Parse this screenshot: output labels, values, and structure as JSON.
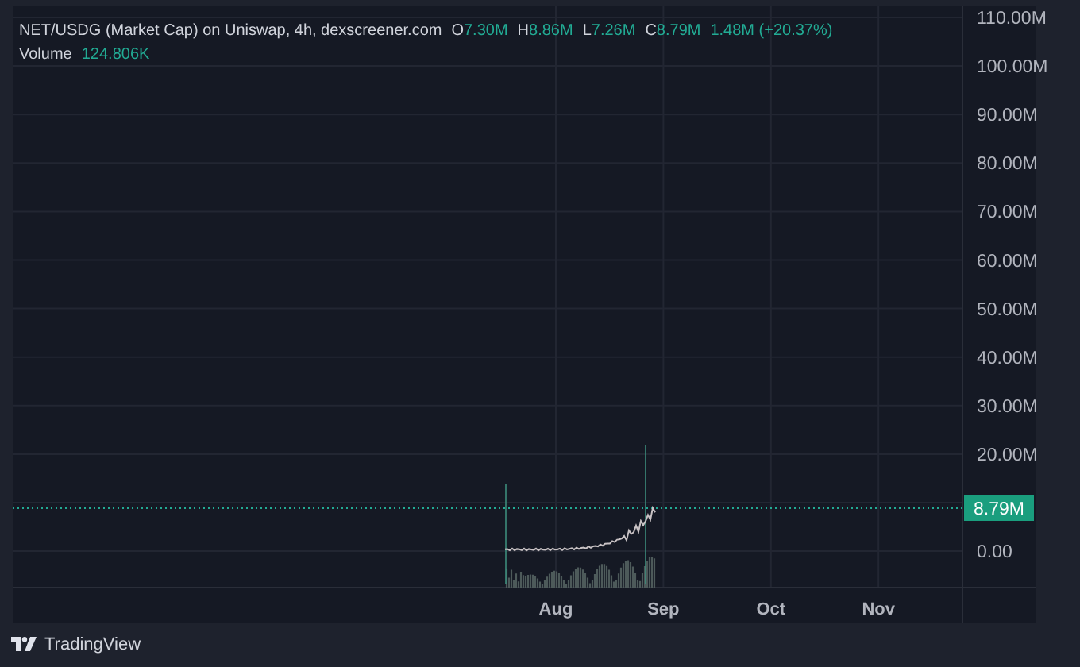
{
  "legend": {
    "title": "NET/USDG (Market Cap) on Uniswap, 4h, dexscreener.com",
    "ohlc": [
      {
        "label": "O",
        "value": "7.30M"
      },
      {
        "label": "H",
        "value": "8.86M"
      },
      {
        "label": "L",
        "value": "7.26M"
      },
      {
        "label": "C",
        "value": "8.79M"
      }
    ],
    "change": "1.48M (+20.37%)",
    "volume_label": "Volume",
    "volume_value": "124.806K"
  },
  "price_axis": {
    "ticks": [
      "110.00M",
      "100.00M",
      "90.00M",
      "80.00M",
      "70.00M",
      "60.00M",
      "50.00M",
      "40.00M",
      "30.00M",
      "20.00M",
      "0.00"
    ],
    "last_price": "8.79M"
  },
  "time_axis": {
    "ticks": [
      "Aug",
      "Sep",
      "Oct",
      "Nov"
    ]
  },
  "footer": {
    "brand": "TradingView"
  }
}
